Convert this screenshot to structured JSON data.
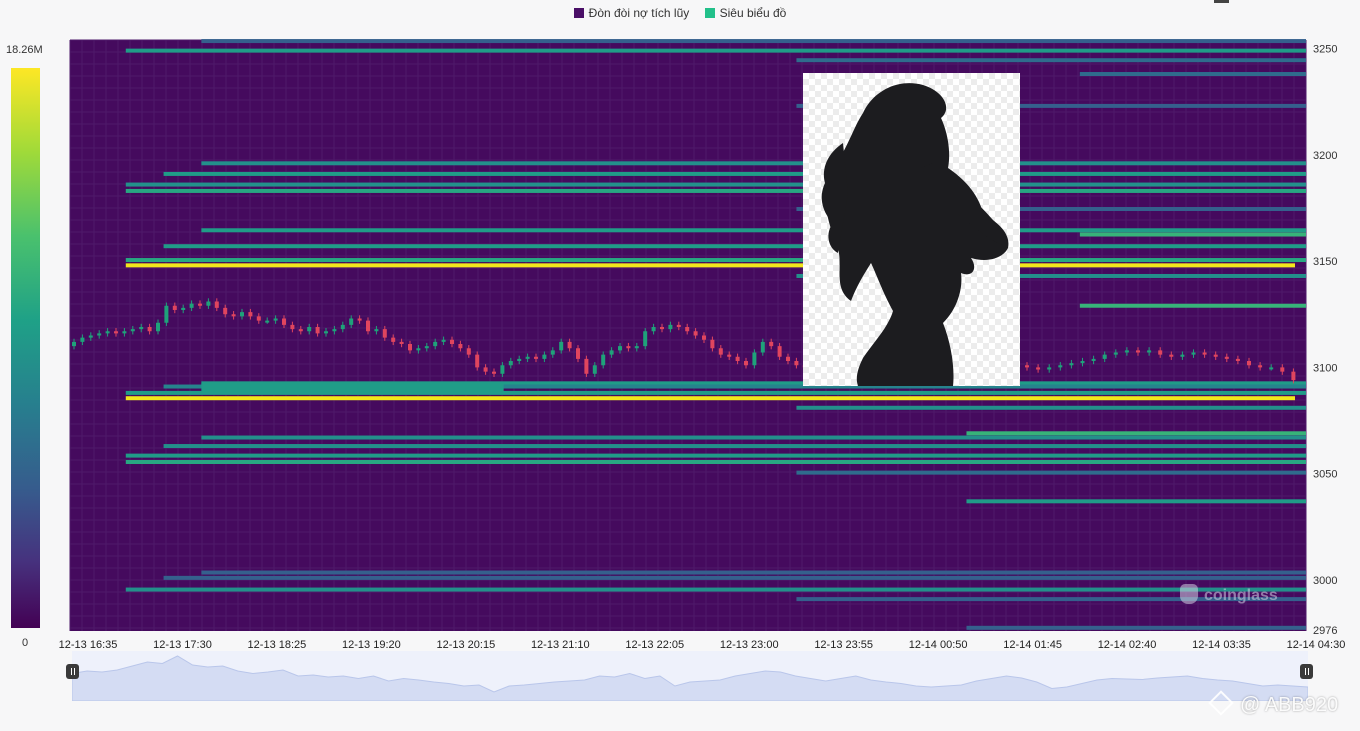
{
  "legend": {
    "items": [
      {
        "label": "Đòn đòi nợ tích lũy",
        "color": "#4a0f67"
      },
      {
        "label": "Siêu biểu đồ",
        "color": "#22c08a"
      }
    ]
  },
  "colorbar": {
    "max_label": "18.26M",
    "min_label": "0",
    "stops": [
      "#440154",
      "#46327e",
      "#365c8d",
      "#277f8e",
      "#1fa187",
      "#4ac16d",
      "#a0da39",
      "#fde725"
    ]
  },
  "brand": {
    "logo_text": "coinglass",
    "watermark": "@ ABB920"
  },
  "colors": {
    "heat_base": "#450a5e",
    "up_candle": "#1fa27a",
    "down_candle": "#e0455e",
    "hot_band": "#f2e71b"
  },
  "chart_data": {
    "type": "heatmap",
    "x_tick_labels": [
      "12-13 16:35",
      "12-13 17:30",
      "12-13 18:25",
      "12-13 19:20",
      "12-13 20:15",
      "12-13 21:10",
      "12-13 22:05",
      "12-13 23:00",
      "12-13 23:55",
      "12-14 00:50",
      "12-14 01:45",
      "12-14 02:40",
      "12-14 03:35",
      "12-14 04:30"
    ],
    "y_tick_labels": [
      "3250",
      "3200",
      "3150",
      "3100",
      "3050",
      "3000",
      "2976"
    ],
    "ylim": [
      2976,
      3254
    ],
    "time_range": [
      "12-13 16:35",
      "12-14 04:30"
    ],
    "zmax": "18.26M",
    "bands": [
      {
        "price": 3253.5,
        "start": 1.2,
        "level": 0.3
      },
      {
        "price": 3249.0,
        "start": 0.4,
        "level": 0.55
      },
      {
        "price": 3244.5,
        "start": 7.5,
        "level": 0.35
      },
      {
        "price": 3238.0,
        "start": 10.5,
        "level": 0.35
      },
      {
        "price": 3223.0,
        "start": 7.5,
        "level": 0.3
      },
      {
        "price": 3196.0,
        "start": 1.2,
        "level": 0.5
      },
      {
        "price": 3191.0,
        "start": 0.8,
        "level": 0.55
      },
      {
        "price": 3186.0,
        "start": 0.4,
        "level": 0.5
      },
      {
        "price": 3183.0,
        "start": 0.4,
        "level": 0.6
      },
      {
        "price": 3174.5,
        "start": 7.5,
        "level": 0.3
      },
      {
        "price": 3164.5,
        "start": 1.2,
        "level": 0.55
      },
      {
        "price": 3162.5,
        "start": 10.5,
        "level": 0.65
      },
      {
        "price": 3157.0,
        "start": 0.8,
        "level": 0.55
      },
      {
        "price": 3150.5,
        "start": 0.4,
        "level": 0.6
      },
      {
        "price": 3148.0,
        "start": 0.4,
        "level": 1.0
      },
      {
        "price": 3143.0,
        "start": 7.5,
        "level": 0.5
      },
      {
        "price": 3129.0,
        "start": 10.5,
        "level": 0.65
      },
      {
        "price": 3092.5,
        "start": 1.2,
        "level": 0.55
      },
      {
        "price": 3091.0,
        "start": 0.8,
        "level": 0.45
      },
      {
        "price": 3088.0,
        "start": 0.4,
        "level": 0.55
      },
      {
        "price": 3085.5,
        "start": 0.4,
        "level": 1.0
      },
      {
        "price": 3081.0,
        "start": 7.5,
        "level": 0.5
      },
      {
        "price": 3069.0,
        "start": 9.3,
        "level": 0.65
      },
      {
        "price": 3067.0,
        "start": 1.2,
        "level": 0.5
      },
      {
        "price": 3063.0,
        "start": 0.8,
        "level": 0.5
      },
      {
        "price": 3058.5,
        "start": 0.4,
        "level": 0.55
      },
      {
        "price": 3055.5,
        "start": 0.4,
        "level": 0.6
      },
      {
        "price": 3050.5,
        "start": 7.5,
        "level": 0.35
      },
      {
        "price": 3037.0,
        "start": 9.3,
        "level": 0.55
      },
      {
        "price": 3003.5,
        "start": 1.2,
        "level": 0.3
      },
      {
        "price": 3001.0,
        "start": 0.8,
        "level": 0.3
      },
      {
        "price": 2995.5,
        "start": 0.4,
        "level": 0.5
      },
      {
        "price": 2991.0,
        "start": 7.5,
        "level": 0.3
      },
      {
        "price": 2977.5,
        "start": 9.3,
        "level": 0.3
      }
    ],
    "bands_time_unit": "x_tick_index",
    "side_band": {
      "price_from": 3092.5,
      "price_to": 3090.0,
      "start": 1.2,
      "end": 4.4,
      "level": 0.55
    },
    "candles_close": [
      3112,
      3114,
      3115,
      3116,
      3117,
      3116,
      3117,
      3118,
      3119,
      3117,
      3121,
      3129,
      3127,
      3128,
      3130,
      3129,
      3131,
      3128,
      3125,
      3124,
      3126,
      3124,
      3122,
      3122,
      3123,
      3120,
      3118,
      3117,
      3119,
      3116,
      3117,
      3118,
      3120,
      3123,
      3122,
      3117,
      3118,
      3114,
      3112,
      3111,
      3108,
      3109,
      3110,
      3112,
      3113,
      3111,
      3109,
      3106,
      3100,
      3098,
      3097,
      3101,
      3103,
      3104,
      3105,
      3104,
      3106,
      3108,
      3112,
      3109,
      3104,
      3097,
      3101,
      3106,
      3108,
      3110,
      3109,
      3110,
      3117,
      3119,
      3118,
      3120,
      3119,
      3117,
      3115,
      3113,
      3109,
      3106,
      3105,
      3103,
      3101,
      3107,
      3112,
      3110,
      3105,
      3103,
      3101,
      3100
    ],
    "candles_close_right": [
      3100,
      3099,
      3100,
      3101,
      3102,
      3103,
      3104,
      3106,
      3107,
      3108,
      3107,
      3108,
      3106,
      3105,
      3106,
      3107,
      3106,
      3105,
      3104,
      3103,
      3101,
      3100,
      3100,
      3098,
      3094
    ],
    "overview_series": [
      0.55,
      0.6,
      0.58,
      0.62,
      0.7,
      0.78,
      0.75,
      0.9,
      0.72,
      0.68,
      0.7,
      0.6,
      0.55,
      0.58,
      0.62,
      0.5,
      0.52,
      0.48,
      0.5,
      0.45,
      0.5,
      0.4,
      0.45,
      0.42,
      0.38,
      0.35,
      0.3,
      0.32,
      0.18,
      0.3,
      0.32,
      0.35,
      0.38,
      0.4,
      0.42,
      0.5,
      0.48,
      0.55,
      0.45,
      0.5,
      0.3,
      0.38,
      0.4,
      0.42,
      0.5,
      0.55,
      0.6,
      0.58,
      0.5,
      0.45,
      0.4,
      0.45,
      0.5,
      0.42,
      0.38,
      0.35,
      0.3,
      0.28,
      0.3,
      0.32,
      0.4,
      0.45,
      0.5,
      0.46,
      0.38,
      0.25,
      0.28,
      0.35,
      0.42,
      0.45,
      0.44,
      0.43,
      0.46,
      0.48,
      0.5,
      0.45,
      0.42,
      0.4,
      0.35,
      0.3,
      0.32,
      0.3,
      0.28
    ]
  }
}
